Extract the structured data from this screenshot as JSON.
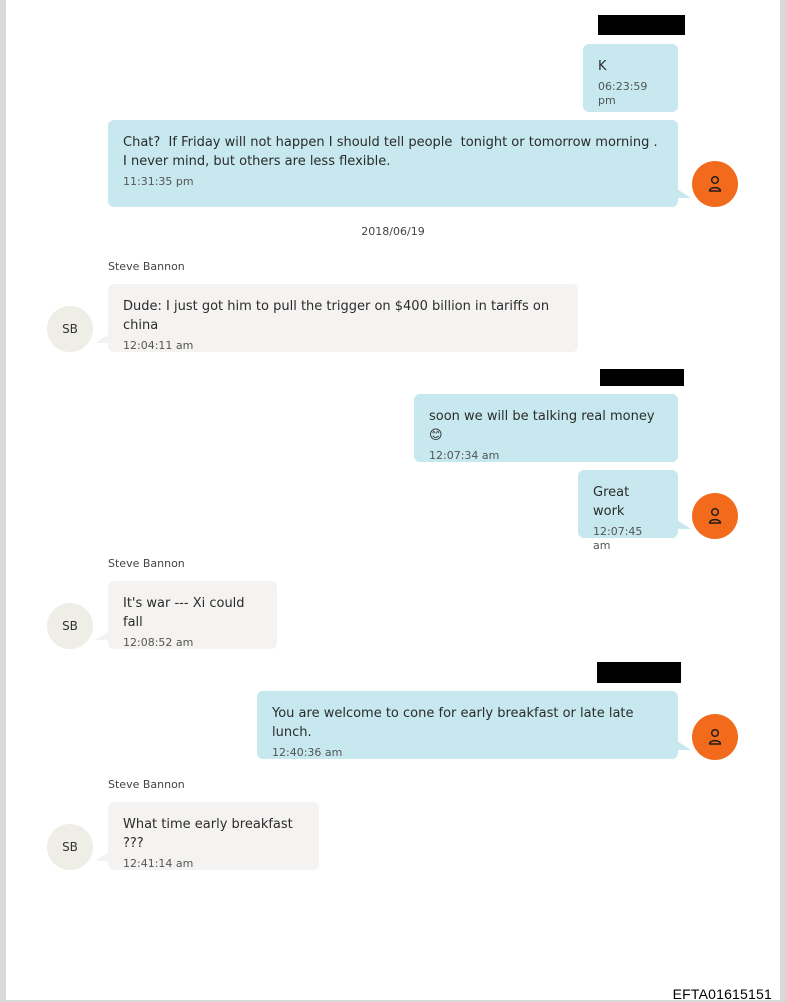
{
  "conversation": {
    "date_separator": "2018/06/19",
    "contact_name": "Steve Bannon",
    "contact_initials": "SB",
    "messages": [
      {
        "direction": "outgoing",
        "text": "K",
        "time": "06:23:59 pm"
      },
      {
        "direction": "outgoing",
        "text": "Chat?  If Friday will not happen I should tell people  tonight or tomorrow morning .  I never mind, but others are less flexible.",
        "time": "11:31:35 pm"
      },
      {
        "direction": "incoming",
        "sender": "Steve Bannon",
        "text": "Dude: I just got him to pull the trigger on $400 billion in tariffs on china",
        "time": "12:04:11 am"
      },
      {
        "direction": "outgoing",
        "text": "soon we will be talking real money 😊",
        "time": "12:07:34 am"
      },
      {
        "direction": "outgoing",
        "text": "Great work",
        "time": "12:07:45 am"
      },
      {
        "direction": "incoming",
        "sender": "Steve Bannon",
        "text": "It's war --- Xi could fall",
        "time": "12:08:52 am"
      },
      {
        "direction": "outgoing",
        "text": "You are welcome to cone for early breakfast or late late lunch.",
        "time": "12:40:36 am"
      },
      {
        "direction": "incoming",
        "sender": "Steve Bannon",
        "text": "What time early breakfast ???",
        "time": "12:41:14 am"
      }
    ]
  },
  "footer": {
    "document_id": "EFTA01615151"
  },
  "icons": {
    "own_avatar": "person-icon"
  },
  "colors": {
    "outgoing_bubble": "#c6e8ee",
    "incoming_bubble": "#f4f3f1",
    "own_avatar": "#f26a1b",
    "contact_avatar": "#eeede6"
  }
}
